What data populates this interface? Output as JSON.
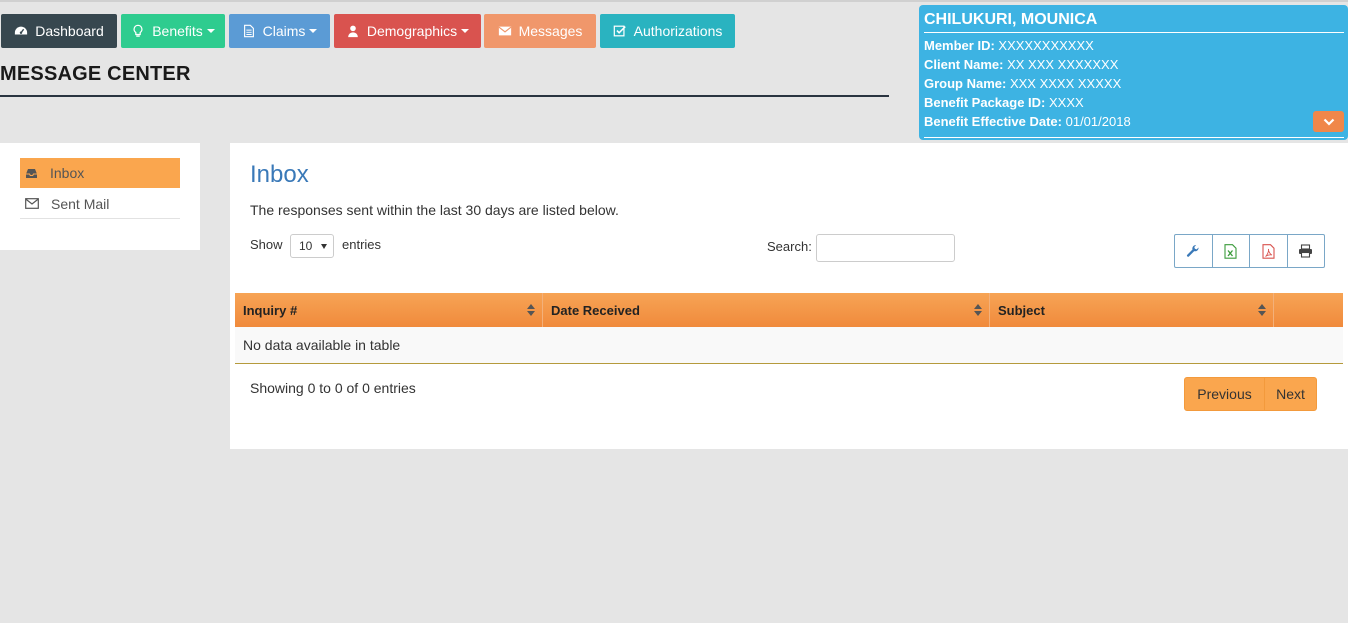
{
  "nav": {
    "items": [
      {
        "label": "Dashboard",
        "icon": "dashboard-icon",
        "color": "#37474f",
        "dropdown": false
      },
      {
        "label": "Benefits",
        "icon": "lightbulb-icon",
        "color": "#2ecc8f",
        "dropdown": true
      },
      {
        "label": "Claims",
        "icon": "document-icon",
        "color": "#5b9bd5",
        "dropdown": true
      },
      {
        "label": "Demographics",
        "icon": "user-icon",
        "color": "#d9534f",
        "dropdown": true
      },
      {
        "label": "Messages",
        "icon": "envelope-icon",
        "color": "#f0976b",
        "dropdown": false
      },
      {
        "label": "Authorizations",
        "icon": "check-square-icon",
        "color": "#2ab3c0",
        "dropdown": false
      }
    ]
  },
  "page": {
    "title": "MESSAGE CENTER"
  },
  "member": {
    "name": "CHILUKURI, MOUNICA",
    "fields": [
      {
        "label": "Member ID:",
        "value": "XXXXXXXXXXX"
      },
      {
        "label": "Client Name:",
        "value": "XX XXX XXXXXXX"
      },
      {
        "label": "Group Name:",
        "value": "XXX XXXX XXXXX"
      },
      {
        "label": "Benefit Package ID:",
        "value": "XXXX"
      },
      {
        "label": "Benefit Effective Date:",
        "value": "01/01/2018"
      }
    ],
    "card_color": "#3db3e3"
  },
  "sidebar": {
    "items": [
      {
        "label": "Inbox",
        "icon": "inbox-icon",
        "active": true
      },
      {
        "label": "Sent Mail",
        "icon": "envelope-icon",
        "active": false
      }
    ]
  },
  "inbox": {
    "title": "Inbox",
    "subtitle": "The responses sent within the last 30 days are listed below.",
    "show_label": "Show",
    "entries_label": "entries",
    "page_length": "10",
    "search_label": "Search:",
    "search_value": "",
    "tools": [
      "wrench-icon",
      "excel-icon",
      "pdf-icon",
      "print-icon"
    ],
    "columns": [
      "Inquiry #",
      "Date Received",
      "Subject",
      ""
    ],
    "empty_message": "No data available in table",
    "info": "Showing 0 to 0 of 0 entries",
    "previous_label": "Previous",
    "next_label": "Next"
  },
  "colors": {
    "accent_orange": "#faa64e",
    "header_orange": "#f08a3c",
    "title_blue": "#3a79b8"
  }
}
